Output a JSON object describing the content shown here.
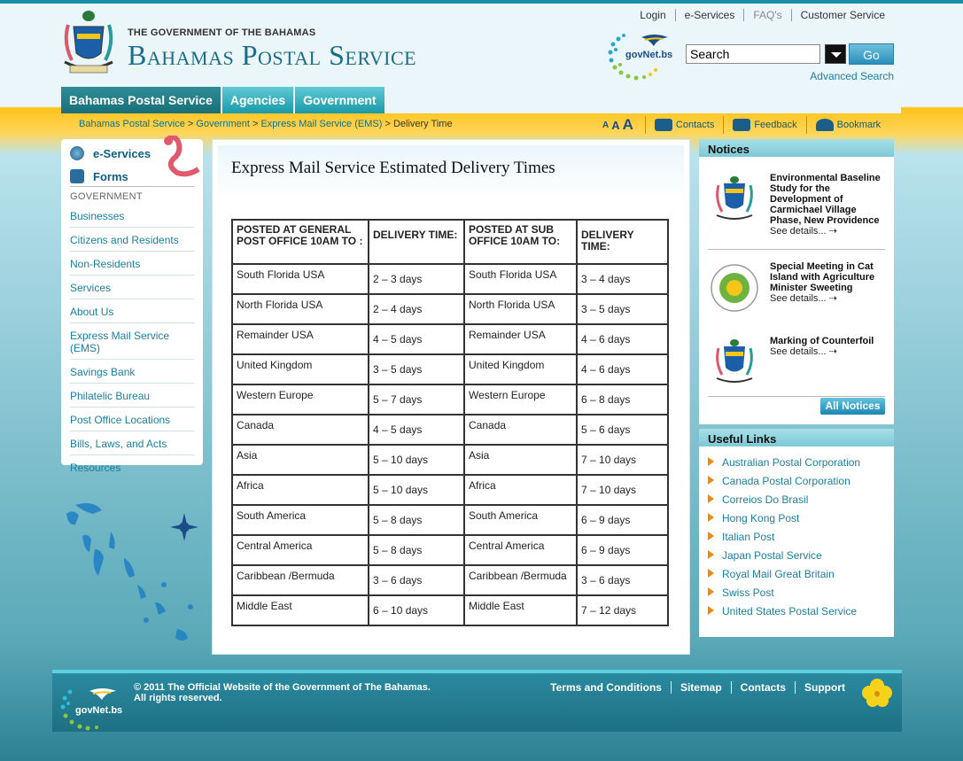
{
  "header": {
    "gov_line": "THE GOVERNMENT OF THE BAHAMAS",
    "site_title": "Bahamas Postal Service",
    "top_links": [
      "Login",
      "e-Services",
      "FAQ's",
      "Customer Service"
    ],
    "govnet_label": "govNet.bs",
    "search": {
      "value": "Search",
      "go_label": "Go",
      "advanced_label": "Advanced Search"
    }
  },
  "nav": {
    "tabs": [
      "Bahamas Postal Service",
      "Agencies",
      "Government"
    ]
  },
  "breadcrumb": {
    "items": [
      "Bahamas Postal Service",
      "Government",
      "Express Mail Service (EMS)"
    ],
    "current": "Delivery Time",
    "sep": " > "
  },
  "tools": {
    "font_small": "A",
    "font_medium": "A",
    "font_large": "A",
    "contacts": "Contacts",
    "feedback": "Feedback",
    "bookmark": "Bookmark"
  },
  "sidebar": {
    "eservices": "e-Services",
    "forms": "Forms",
    "gov_label": "GOVERNMENT",
    "items": [
      "Businesses",
      "Citizens and Residents",
      "Non-Residents",
      "Services",
      "About Us",
      "Express Mail Service (EMS)",
      "Savings Bank",
      "Philatelic Bureau",
      "Post Office Locations",
      "Bills, Laws, and Acts",
      "Resources"
    ]
  },
  "main": {
    "title": "Express Mail Service Estimated Delivery Times",
    "table": {
      "headers": [
        "POSTED AT GENERAL POST OFFICE 10AM TO :",
        "DELIVERY TIME:",
        "POSTED AT SUB OFFICE 10AM TO:",
        "DELIVERY TIME:"
      ],
      "rows": [
        [
          "South Florida USA",
          "2 – 3 days",
          "South Florida USA",
          "3 – 4 days"
        ],
        [
          "North Florida USA",
          "2 – 4 days",
          "North Florida USA",
          "3 – 5 days"
        ],
        [
          "Remainder USA",
          "4 – 5 days",
          "Remainder USA",
          "4 – 6 days"
        ],
        [
          "United Kingdom",
          "3 – 5 days",
          "United Kingdom",
          "4 – 6 days"
        ],
        [
          "Western Europe",
          "5 – 7 days",
          "Western Europe",
          "6 – 8 days"
        ],
        [
          "Canada",
          "4 – 5 days",
          "Canada",
          "5 – 6 days"
        ],
        [
          "Asia",
          "5 – 10 days",
          "Asia",
          "7 – 10 days"
        ],
        [
          "Africa",
          "5 – 10 days",
          "Africa",
          "7 – 10 days"
        ],
        [
          "South America",
          "5 – 8 days",
          "South America",
          "6 – 9 days"
        ],
        [
          "Central America",
          "5 – 8 days",
          "Central America",
          "6 – 9 days"
        ],
        [
          "Caribbean /Bermuda",
          "3 – 6 days",
          "Caribbean /Bermuda",
          "3 – 6 days"
        ],
        [
          "Middle East",
          "6 – 10 days",
          "Middle East",
          "7 – 12 days"
        ]
      ]
    }
  },
  "notices": {
    "title": "Notices",
    "items": [
      {
        "title": "Environmental Baseline Study for the Development of Carmichael Village Phase, New Providence",
        "more": "See details... ⇢"
      },
      {
        "title": "Special Meeting in Cat Island with Agriculture Minister Sweeting",
        "more": "See details... ⇢"
      },
      {
        "title": "Marking of Counterfoil",
        "more": "See details... ⇢"
      }
    ],
    "all_label": "All Notices"
  },
  "useful_links": {
    "title": "Useful Links",
    "items": [
      "Australian Postal Corporation",
      "Canada Postal Corporation",
      "Correios Do Brasil",
      "Hong Kong Post",
      "Italian Post",
      "Japan Postal Service",
      "Royal Mail Great Britain",
      "Swiss Post",
      "United States Postal Service"
    ]
  },
  "footer": {
    "copyright_line1": "© 2011 The Official Website of the Government of The Bahamas.",
    "copyright_line2": "All rights reserved.",
    "govnet_label": "govNet.bs",
    "links": [
      "Terms and Conditions",
      "Sitemap",
      "Contacts",
      "Support"
    ]
  },
  "colors": {
    "accent": "#1a9aaa",
    "link": "#1a7fa0",
    "band": "#ffc21a",
    "arrow": "#f08a00"
  }
}
